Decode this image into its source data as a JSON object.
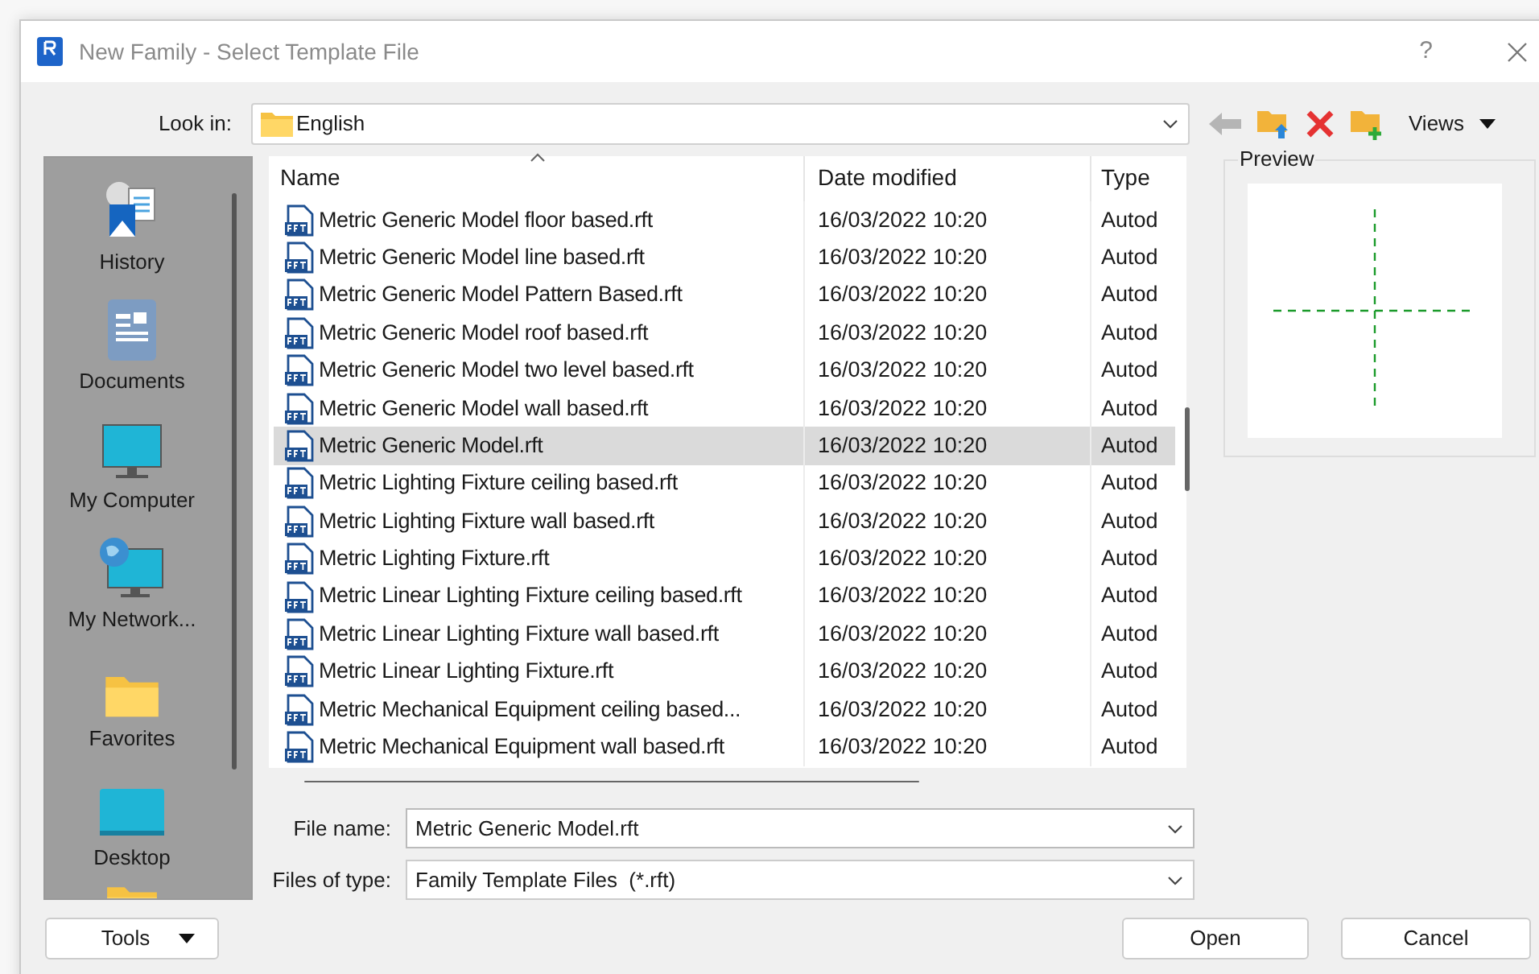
{
  "window": {
    "title": "New Family - Select Template File",
    "help": "?"
  },
  "look_in": {
    "label": "Look in:",
    "value": "English"
  },
  "toolbar": {
    "views": "Views"
  },
  "places": [
    {
      "label": "History",
      "kind": "history"
    },
    {
      "label": "Documents",
      "kind": "documents"
    },
    {
      "label": "My Computer",
      "kind": "computer"
    },
    {
      "label": "My Network...",
      "kind": "network"
    },
    {
      "label": "Favorites",
      "kind": "folder"
    },
    {
      "label": "Desktop",
      "kind": "desktop"
    }
  ],
  "table": {
    "columns": [
      "Name",
      "Date modified",
      "Type"
    ],
    "rows": [
      {
        "name": "Metric Generic Model floor based.rft",
        "date": "16/03/2022 10:20",
        "type": "Autod",
        "selected": false
      },
      {
        "name": "Metric Generic Model line based.rft",
        "date": "16/03/2022 10:20",
        "type": "Autod",
        "selected": false
      },
      {
        "name": "Metric Generic Model Pattern Based.rft",
        "date": "16/03/2022 10:20",
        "type": "Autod",
        "selected": false
      },
      {
        "name": "Metric Generic Model roof based.rft",
        "date": "16/03/2022 10:20",
        "type": "Autod",
        "selected": false
      },
      {
        "name": "Metric Generic Model two level based.rft",
        "date": "16/03/2022 10:20",
        "type": "Autod",
        "selected": false
      },
      {
        "name": "Metric Generic Model wall based.rft",
        "date": "16/03/2022 10:20",
        "type": "Autod",
        "selected": false
      },
      {
        "name": "Metric Generic Model.rft",
        "date": "16/03/2022 10:20",
        "type": "Autod",
        "selected": true
      },
      {
        "name": "Metric Lighting Fixture ceiling based.rft",
        "date": "16/03/2022 10:20",
        "type": "Autod",
        "selected": false
      },
      {
        "name": "Metric Lighting Fixture wall based.rft",
        "date": "16/03/2022 10:20",
        "type": "Autod",
        "selected": false
      },
      {
        "name": "Metric Lighting Fixture.rft",
        "date": "16/03/2022 10:20",
        "type": "Autod",
        "selected": false
      },
      {
        "name": "Metric Linear Lighting Fixture ceiling based.rft",
        "date": "16/03/2022 10:20",
        "type": "Autod",
        "selected": false
      },
      {
        "name": "Metric Linear Lighting Fixture wall based.rft",
        "date": "16/03/2022 10:20",
        "type": "Autod",
        "selected": false
      },
      {
        "name": "Metric Linear Lighting Fixture.rft",
        "date": "16/03/2022 10:20",
        "type": "Autod",
        "selected": false
      },
      {
        "name": "Metric Mechanical Equipment ceiling based...",
        "date": "16/03/2022 10:20",
        "type": "Autod",
        "selected": false
      },
      {
        "name": "Metric Mechanical Equipment wall based.rft",
        "date": "16/03/2022 10:20",
        "type": "Autod",
        "selected": false
      }
    ]
  },
  "preview": {
    "label": "Preview"
  },
  "file_name": {
    "label": "File name:",
    "value": "Metric Generic Model.rft"
  },
  "file_type": {
    "label": "Files of type:",
    "value": "Family Template Files  (*.rft)"
  },
  "buttons": {
    "tools": "Tools",
    "open": "Open",
    "cancel": "Cancel"
  }
}
